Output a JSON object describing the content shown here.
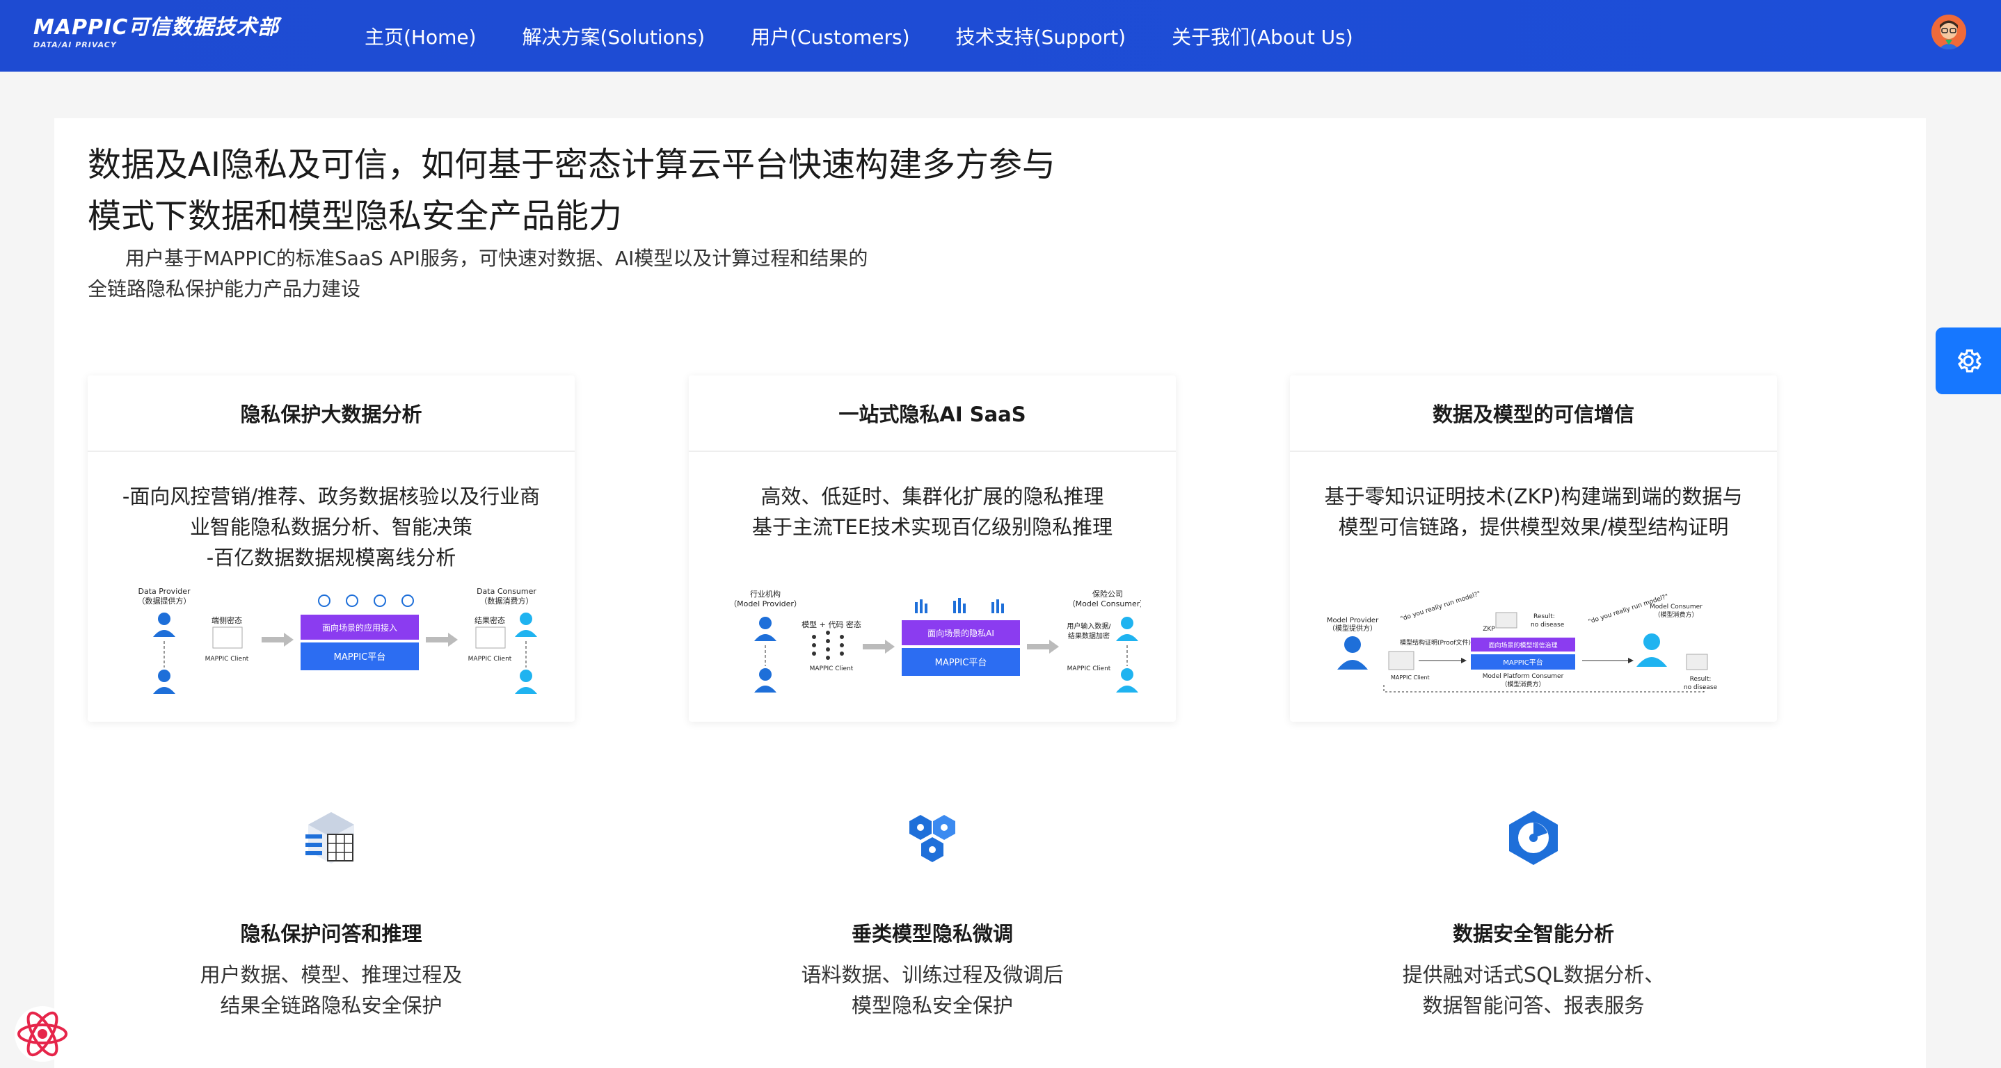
{
  "header": {
    "logo_title": "MAPPIC可信数据技术部",
    "logo_subtitle": "DATA/AI PRIVACY",
    "nav": [
      {
        "label": "主页(Home)"
      },
      {
        "label": "解决方案(Solutions)"
      },
      {
        "label": "用户(Customers)"
      },
      {
        "label": "技术支持(Support)"
      },
      {
        "label": "关于我们(About Us)"
      }
    ]
  },
  "hero": {
    "title_line1": "数据及AI隐私及可信，如何基于密态计算云平台快速构建多方参与",
    "title_line2": "模式下数据和模型隐私安全产品能力",
    "desc_line1": "用户基于MAPPIC的标准SaaS API服务，可快速对数据、AI模型以及计算过程和结果的",
    "desc_line2": "全链路隐私保护能力产品力建设"
  },
  "cards": [
    {
      "title": "隐私保护大数据分析",
      "lines": [
        "-面向风控营销/推荐、政务数据核验以及行业商",
        "业智能隐私数据分析、智能决策",
        "-百亿数据数据规模离线分析"
      ],
      "diagram": {
        "left_label": "Data Provider",
        "left_sub": "（数据提供方）",
        "mid_text": "端侧密态",
        "client": "MAPPIC Client",
        "top_box": "面向场景的应用接入",
        "bottom_box": "MAPPIC平台",
        "right_label": "Data Consumer",
        "right_sub": "（数据消费方）",
        "right_text": "结果密态",
        "right_client": "MAPPIC Client"
      }
    },
    {
      "title": "一站式隐私AI SaaS",
      "lines": [
        "高效、低延时、集群化扩展的隐私推理",
        "基于主流TEE技术实现百亿级别隐私推理"
      ],
      "diagram": {
        "left_label": "行业机构",
        "left_sub": "（Model Provider）",
        "mid_text": "模型 + 代码 密态",
        "client": "MAPPIC Client",
        "top_box": "面向场景的隐私AI",
        "bottom_box": "MAPPIC平台",
        "right_label": "保险公司",
        "right_sub": "（Model Consumer）",
        "right_text": "用户输入数据/",
        "right_text2": "结果数据加密",
        "right_client": "MAPPIC Client"
      }
    },
    {
      "title": "数据及模型的可信增信",
      "lines": [
        "基于零知识证明技术(ZKP)构建端到端的数据与",
        "模型可信链路，提供模型效果/模型结构证明"
      ],
      "diagram": {
        "left_label": "Model Provider",
        "left_sub": "（模型提供方）",
        "quote1": "\"do you really run model?\"",
        "quote2": "\"do you really run model?\"",
        "proof_text": "模型结构证明(Proof文件)",
        "client": "MAPPIC Client",
        "zkp": "ZKP",
        "result1": "Result:",
        "result1b": "no disease",
        "top_box": "面向场景的模型增信治理",
        "bottom_box": "MAPPIC平台",
        "platform_label": "Model Platform Consumer",
        "platform_sub": "（模型消费方）",
        "right_label": "Model Consumer",
        "right_sub": "（模型消费方）",
        "result2": "Result:",
        "result2b": "no disease"
      }
    }
  ],
  "services": [
    {
      "icon": "data-cube-icon",
      "title": "隐私保护问答和推理",
      "lines": [
        "用户数据、模型、推理过程及",
        "结果全链路隐私安全保护"
      ]
    },
    {
      "icon": "hexagon-cluster-icon",
      "title": "垂类模型隐私微调",
      "lines": [
        "语料数据、训练过程及微调后",
        "模型隐私安全保护"
      ]
    },
    {
      "icon": "hexagon-chart-icon",
      "title": "数据安全智能分析",
      "lines": [
        "提供融对话式SQL数据分析、",
        "数据智能问答、报表服务"
      ]
    }
  ],
  "colors": {
    "header": "#1d4ed8",
    "accent": "#1677ff",
    "purple": "#8b3cf0"
  }
}
